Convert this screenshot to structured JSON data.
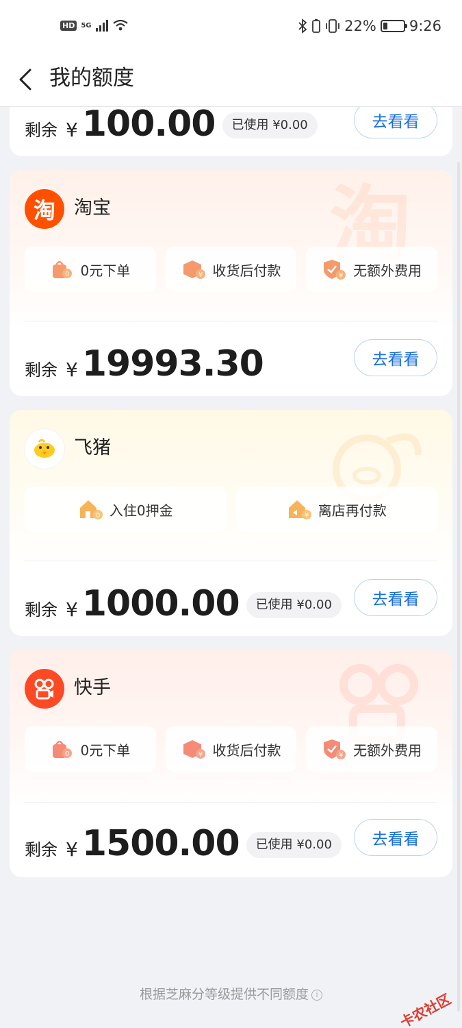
{
  "status_bar": {
    "left_badge": "HD",
    "network": "5G",
    "bluetooth_icon": "bluetooth-icon",
    "battery_percent": "22%",
    "battery_level": 0.22,
    "time": "9:26"
  },
  "header": {
    "back_icon": "chevron-left-icon",
    "title": "我的额度"
  },
  "cards": [
    {
      "id": "partial",
      "remain_label": "剩余",
      "currency": "¥",
      "amount": "100.00",
      "used": "已使用 ¥0.00",
      "button": "去看看"
    },
    {
      "id": "taobao",
      "brand": "淘宝",
      "logo_char": "淘",
      "features": [
        "0元下单",
        "收货后付款",
        "无额外费用"
      ],
      "remain_label": "剩余",
      "currency": "¥",
      "amount": "19993.30",
      "button": "去看看"
    },
    {
      "id": "fliggy",
      "brand": "飞猪",
      "features": [
        "入住0押金",
        "离店再付款"
      ],
      "remain_label": "剩余",
      "currency": "¥",
      "amount": "1000.00",
      "used": "已使用 ¥0.00",
      "button": "去看看"
    },
    {
      "id": "kuaishou",
      "brand": "快手",
      "features": [
        "0元下单",
        "收货后付款",
        "无额外费用"
      ],
      "remain_label": "剩余",
      "currency": "¥",
      "amount": "1500.00",
      "used": "已使用 ¥0.00",
      "button": "去看看"
    }
  ],
  "footer": {
    "note": "根据芝麻分等级提供不同额度"
  },
  "corner_watermark": "卡农社区",
  "colors": {
    "accent_blue": "#1a6fd9",
    "taobao_orange": "#ff5000",
    "kuaishou_orange": "#fe4a24",
    "fliggy_yellow": "#ffd32f"
  }
}
